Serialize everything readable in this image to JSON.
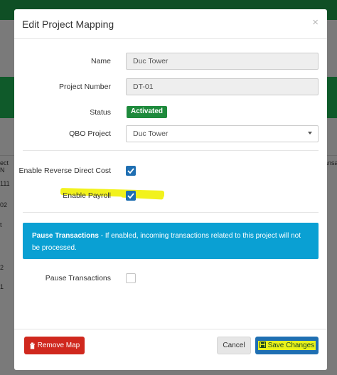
{
  "background": {
    "left_rows": [
      "ect N",
      "111",
      "02",
      "t",
      "2",
      "1"
    ],
    "right_col": "ansa"
  },
  "modal": {
    "title": "Edit Project Mapping",
    "close_glyph": "×",
    "fields": {
      "name_label": "Name",
      "name_value": "Duc Tower",
      "project_number_label": "Project Number",
      "project_number_value": "DT-01",
      "status_label": "Status",
      "status_value": "Activated",
      "qbo_project_label": "QBO Project",
      "qbo_project_value": "Duc Tower"
    },
    "options": {
      "reverse_direct_cost_label": "Enable Reverse Direct Cost",
      "reverse_direct_cost_checked": true,
      "payroll_label": "Enable Payroll",
      "payroll_checked": true
    },
    "alert": {
      "title": "Pause Transactions",
      "text": " - If enabled, incoming transactions related to this project will not be processed."
    },
    "pause": {
      "label": "Pause Transactions",
      "checked": false
    },
    "footer": {
      "remove_label": "Remove Map",
      "cancel_label": "Cancel",
      "save_label": "Save Changes"
    }
  },
  "colors": {
    "accent_blue": "#1f6fb2",
    "status_green": "#1e8a3c",
    "danger_red": "#d0281e",
    "alert_blue": "#0aa0d3",
    "highlight_yellow": "#f2f21d"
  }
}
